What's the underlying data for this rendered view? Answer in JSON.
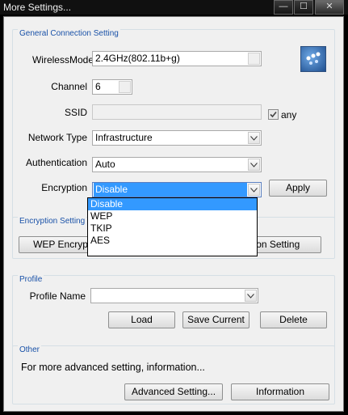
{
  "window": {
    "title": "More Settings...",
    "controls": {
      "minimize": "—",
      "maximize": "☐",
      "close": "✕"
    }
  },
  "general": {
    "title": "General Connection Setting",
    "wireless_mode_label": "WirelessMode",
    "wireless_mode_value": "2.4GHz(802.11b+g)",
    "channel_label": "Channel",
    "channel_value": "6",
    "ssid_label": "SSID",
    "ssid_value": "",
    "any_label": "any",
    "any_checked": true,
    "network_type_label": "Network Type",
    "network_type_value": "Infrastructure",
    "authentication_label": "Authentication",
    "authentication_value": "Auto",
    "encryption_label": "Encryption",
    "encryption_value": "Disable",
    "encryption_options": [
      "Disable",
      "WEP",
      "TKIP",
      "AES"
    ],
    "apply_label": "Apply"
  },
  "encryption_setting": {
    "title": "Encryption Setting",
    "wep_button": "WEP Encryption Key Setting",
    "wpa_button": "WPA Encryption Setting"
  },
  "profile": {
    "title": "Profile",
    "name_label": "Profile Name",
    "name_value": "",
    "load_label": "Load",
    "save_label": "Save Current",
    "delete_label": "Delete"
  },
  "other": {
    "title": "Other",
    "text": "For more advanced setting, information...",
    "advanced_label": "Advanced Setting...",
    "information_label": "Information"
  },
  "colors": {
    "group_title": "#1a52a8",
    "selection": "#3399ff",
    "client_bg": "#f0f0f0"
  },
  "icons": {
    "logo": "wireless-logo-icon",
    "dropdown": "chevron-down-icon",
    "check": "checkmark-icon"
  }
}
